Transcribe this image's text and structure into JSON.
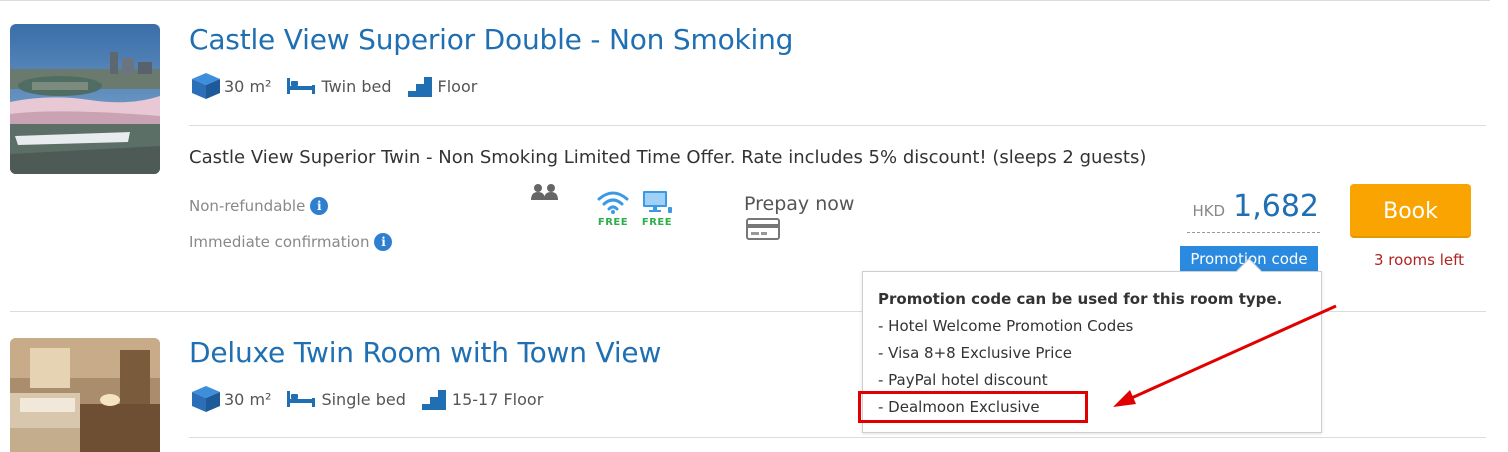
{
  "rooms": [
    {
      "title": "Castle View Superior Double - Non Smoking",
      "area": "30 m²",
      "bed": "Twin bed",
      "floor": "Floor",
      "area_icon": "cube-icon",
      "bed_icon": "bed-icon",
      "floor_icon": "stairs-icon"
    },
    {
      "title": "Deluxe Twin Room with Town View",
      "area": "30 m²",
      "bed": "Single bed",
      "floor": "15-17 Floor",
      "area_icon": "cube-icon",
      "bed_icon": "bed-icon",
      "floor_icon": "stairs-icon"
    }
  ],
  "rate": {
    "description": "Castle View Superior Twin - Non Smoking Limited Time Offer. Rate includes 5% discount! (sleeps 2 guests)",
    "policies": [
      "Non-refundable",
      "Immediate confirmation"
    ],
    "occupancy_icon": "two-guests-icon",
    "amenities": [
      {
        "icon": "wifi-icon",
        "label": "FREE"
      },
      {
        "icon": "computer-icon",
        "label": "FREE"
      }
    ],
    "payment": "Prepay now",
    "payment_icon": "credit-card-icon",
    "currency": "HKD",
    "price": "1,682",
    "promo_badge": "Promotion code",
    "book_label": "Book",
    "availability": "3 rooms left"
  },
  "tooltip": {
    "title": "Promotion code can be used for this room type.",
    "items": [
      "- Hotel Welcome Promotion Codes",
      "- Visa 8+8 Exclusive Price",
      "- PayPal hotel discount",
      "- Dealmoon Exclusive"
    ]
  },
  "colors": {
    "link_blue": "#1f6fb2",
    "icon_blue": "#2f7fd0",
    "book_orange": "#f9a400",
    "promo_blue": "#2a8ae0",
    "availability_red": "#b22222",
    "free_green": "#2db04c",
    "annotation_red": "#e10000"
  }
}
